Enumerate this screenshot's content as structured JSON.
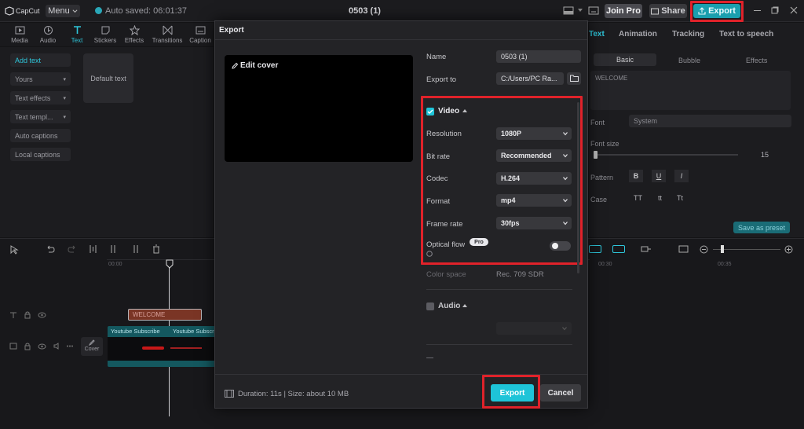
{
  "app": {
    "logo": "CapCut",
    "menu": "Menu",
    "autosave": "Auto saved: 06:01:37",
    "project_title": "0503 (1)",
    "join_pro": "Join Pro",
    "share": "Share",
    "export": "Export"
  },
  "tools": [
    {
      "label": "Media",
      "icon": "media-icon"
    },
    {
      "label": "Audio",
      "icon": "audio-icon"
    },
    {
      "label": "Text",
      "icon": "text-icon"
    },
    {
      "label": "Stickers",
      "icon": "sticker-icon"
    },
    {
      "label": "Effects",
      "icon": "effects-icon"
    },
    {
      "label": "Transitions",
      "icon": "transitions-icon"
    },
    {
      "label": "Caption",
      "icon": "caption-icon"
    }
  ],
  "left_panel": {
    "add_text": "Add text",
    "items": [
      "Yours",
      "Text effects",
      "Text templ...",
      "Auto captions",
      "Local captions"
    ],
    "default_text": "Default text"
  },
  "right_panel": {
    "tabs": [
      "Text",
      "Animation",
      "Tracking",
      "Text to speech"
    ],
    "subtabs": [
      "Basic",
      "Bubble",
      "Effects"
    ],
    "text_value": "WELCOME",
    "font_label": "Font",
    "font_value": "System",
    "font_size_label": "Font size",
    "font_size_value": "15",
    "pattern_label": "Pattern",
    "pattern_buttons": [
      "B",
      "U",
      "I"
    ],
    "case_label": "Case",
    "case_buttons": [
      "TT",
      "tt",
      "Tt"
    ],
    "save_preset": "Save as preset"
  },
  "timeline": {
    "time_start": "00:00",
    "time_mid": "00:30",
    "time_end": "00:35",
    "text_clip": "WELCOME",
    "video_clip_labels": [
      "Youtube Subscribe",
      "Youtube Subscri"
    ],
    "cover_label": "Cover"
  },
  "dialog": {
    "title": "Export",
    "edit_cover": "Edit cover",
    "name_label": "Name",
    "name_value": "0503 (1)",
    "export_to_label": "Export to",
    "export_to_value": "C:/Users/PC Ra...",
    "video_section": "Video",
    "video_enabled": true,
    "fields": [
      {
        "label": "Resolution",
        "value": "1080P"
      },
      {
        "label": "Bit rate",
        "value": "Recommended"
      },
      {
        "label": "Codec",
        "value": "H.264"
      },
      {
        "label": "Format",
        "value": "mp4"
      },
      {
        "label": "Frame rate",
        "value": "30fps"
      }
    ],
    "optical_flow_label": "Optical flow",
    "pro_badge": "Pro",
    "optical_flow_on": false,
    "color_space_label": "Color space",
    "color_space_value": "Rec. 709 SDR",
    "audio_section": "Audio",
    "audio_enabled": false,
    "footer_info": "Duration: 11s | Size: about 10 MB",
    "export_button": "Export",
    "cancel_button": "Cancel"
  },
  "colors": {
    "accent": "#1ec4d8",
    "highlight": "#e0222a",
    "dialog_bg": "#232326",
    "app_bg": "#141416"
  }
}
